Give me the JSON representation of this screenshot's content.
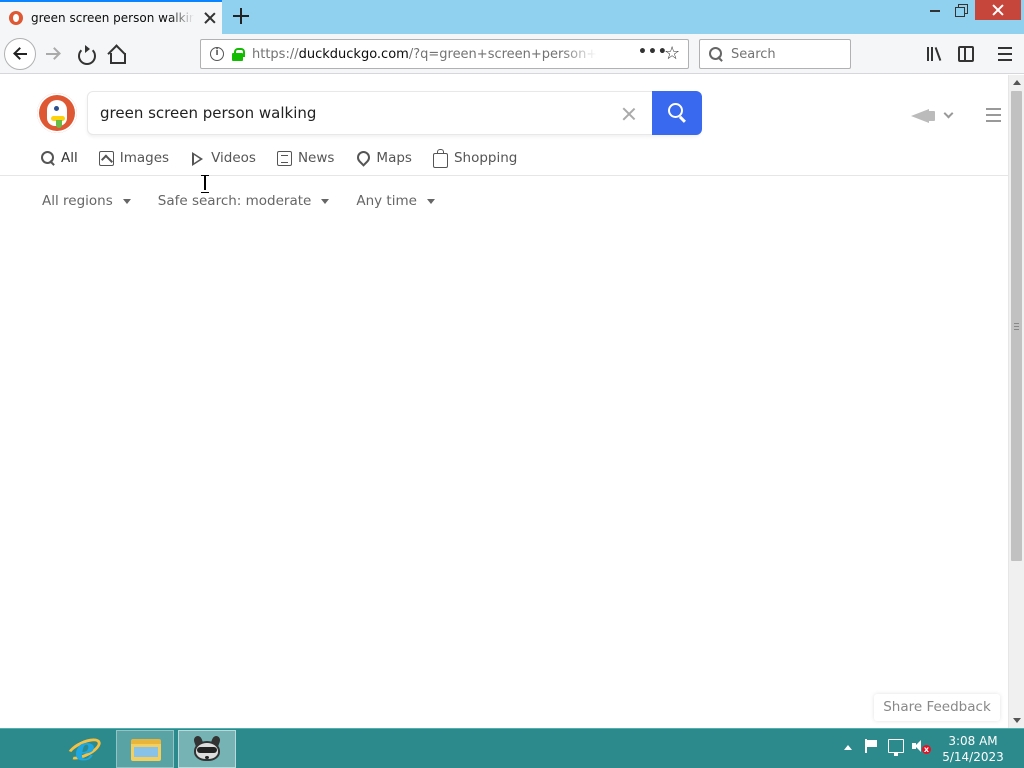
{
  "browser": {
    "tab_title": "green screen person walking at DuckDuckGo",
    "url_host": "duckduckgo.com",
    "url_prefix": "https://",
    "url_path": "/?q=green+screen+person+walking&t=h_&iax=images&ia=images",
    "search_placeholder": "Search"
  },
  "ddg": {
    "query": "green screen person walking",
    "tabs": [
      {
        "label": "All",
        "icon": "search-icon"
      },
      {
        "label": "Images",
        "icon": "image-icon"
      },
      {
        "label": "Videos",
        "icon": "play-icon"
      },
      {
        "label": "News",
        "icon": "news-icon"
      },
      {
        "label": "Maps",
        "icon": "map-pin-icon"
      },
      {
        "label": "Shopping",
        "icon": "shopping-bag-icon"
      }
    ],
    "filters": {
      "region": "All regions",
      "safe_search": "Safe search: moderate",
      "time": "Any time"
    },
    "feedback_label": "Share Feedback",
    "brand_color": "#de5833",
    "accent_color": "#3969ef"
  },
  "taskbar": {
    "time": "3:08 AM",
    "date": "5/14/2023"
  }
}
